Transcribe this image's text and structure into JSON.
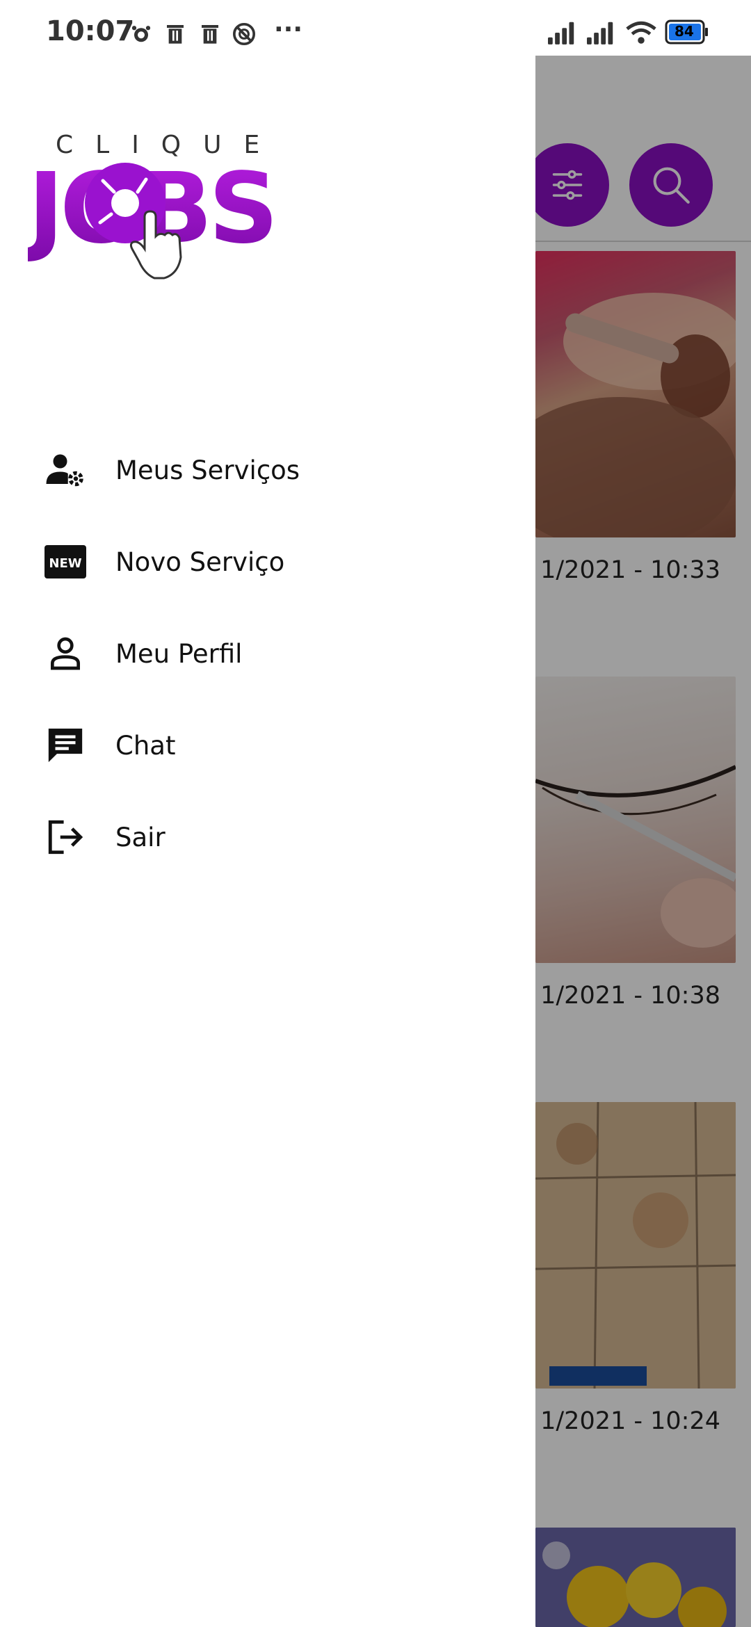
{
  "status_bar": {
    "time": "10:07",
    "more": "···",
    "battery": "84",
    "icons": [
      "alarm-icon",
      "trash-icon",
      "trash-icon",
      "no-sync-icon",
      "signal-icon",
      "signal-icon",
      "wifi-icon",
      "battery-icon"
    ]
  },
  "logo": {
    "top_text": "CLIQUE",
    "main_text": "JOBS",
    "brand_color": "#9a12cf"
  },
  "drawer": {
    "items": [
      {
        "label": "Meus Serviços",
        "icon": "user-gear-icon"
      },
      {
        "label": "Novo Serviço",
        "icon": "new-badge-icon",
        "badge_text": "NEW"
      },
      {
        "label": "Meu Perfil",
        "icon": "person-icon"
      },
      {
        "label": "Chat",
        "icon": "chat-icon"
      },
      {
        "label": "Sair",
        "icon": "logout-icon"
      }
    ]
  },
  "background": {
    "accent": "#8a0fc2",
    "buttons": [
      "filter-icon",
      "search-icon"
    ],
    "cards": [
      {
        "date_text": "1/2021 - 10:33"
      },
      {
        "date_text": "1/2021 - 10:38"
      },
      {
        "date_text": "1/2021 - 10:24"
      }
    ]
  }
}
